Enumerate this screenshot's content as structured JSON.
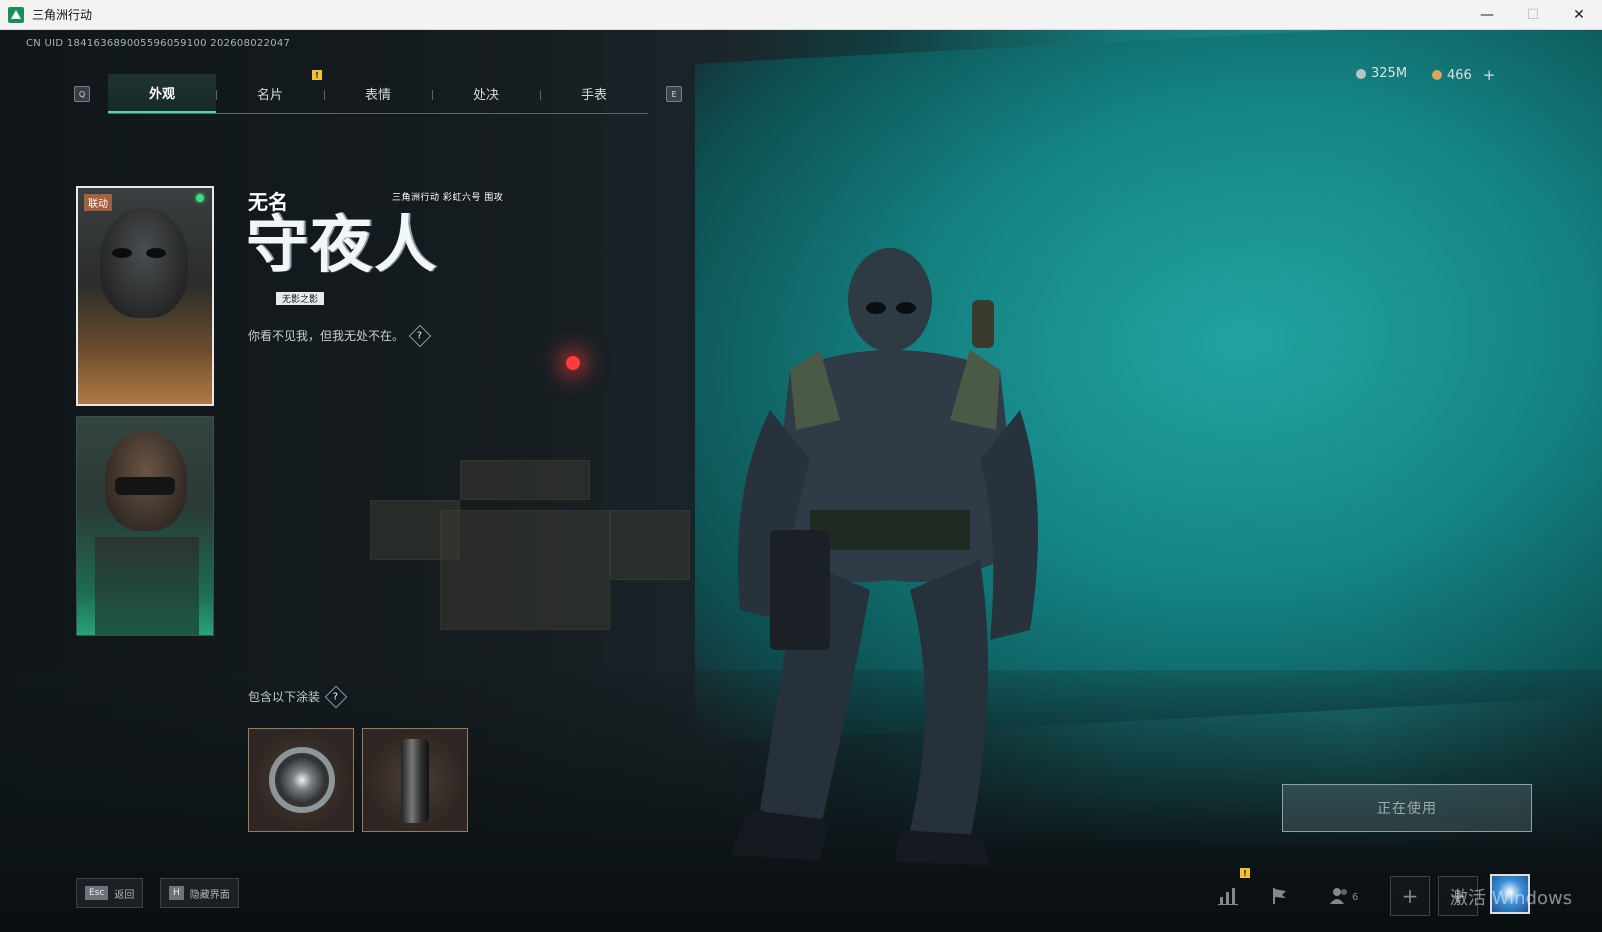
{
  "window": {
    "title": "三角洲行动",
    "controls": {
      "minimize": "—",
      "maximize": "☐",
      "close": "✕"
    }
  },
  "uid": "CN UID 1841636890055960591​00 202608022047",
  "tabs": {
    "prev_key": "Q",
    "next_key": "E",
    "notification": "!",
    "items": [
      {
        "label": "外观",
        "active": true
      },
      {
        "label": "名片",
        "active": false
      },
      {
        "label": "表情",
        "active": false
      },
      {
        "label": "处决",
        "active": false
      },
      {
        "label": "手表",
        "active": false
      }
    ]
  },
  "currency": [
    {
      "icon": "silver-coin-icon",
      "value": "325M",
      "color": "#b9c2c6"
    },
    {
      "icon": "gold-coin-icon",
      "value": "466",
      "color": "#d8a85a"
    }
  ],
  "currency_add": "+",
  "cards": [
    {
      "badge": "联动",
      "selected": true,
      "online": true
    },
    {
      "badge": "",
      "selected": false,
      "online": false
    }
  ],
  "operator": {
    "name_small": "无名",
    "collab": "三角洲行动 彩虹六号 围攻",
    "name_big": "守夜人",
    "subname": "无影之影",
    "tagline": "你看不见我，但我无处不在。",
    "help": "?"
  },
  "skins": {
    "label": "包含以下涂装",
    "help": "?",
    "items": [
      {
        "name": "gear-charm"
      },
      {
        "name": "canister-charm"
      }
    ]
  },
  "inuse_label": "正在使用",
  "bottom": {
    "back_key": "Esc",
    "back_label": "返回",
    "hide_key": "H",
    "hide_label": "隐藏界面",
    "stats_notification": "!",
    "friends_count": "6",
    "plus": "+"
  },
  "watermark": "激活 Windows",
  "colors": {
    "accent": "#3fe0a0",
    "teal_wall": "#1a8786",
    "online": "#39e07e",
    "warning": "#f2c232"
  }
}
